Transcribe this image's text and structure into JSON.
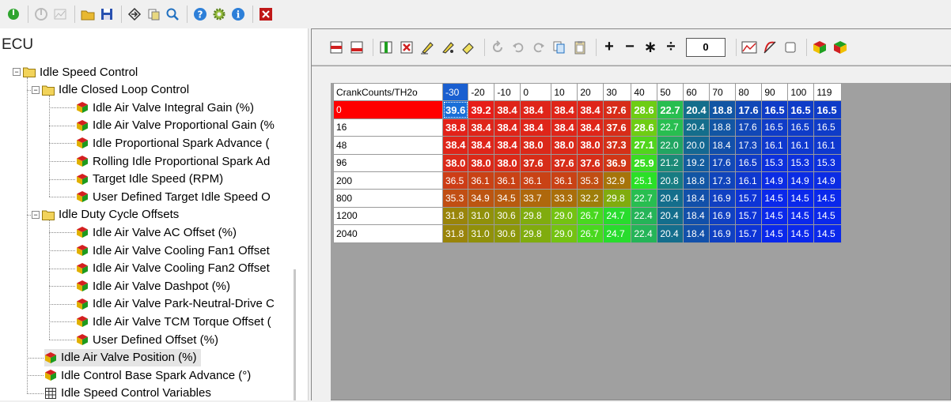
{
  "tree": {
    "title": "ECU",
    "items": [
      {
        "label": "Idle Speed Control",
        "icon": "folder-icon",
        "level": 0,
        "expander": "−"
      },
      {
        "label": "Idle Closed Loop Control",
        "icon": "folder-icon",
        "level": 1,
        "expander": "−"
      },
      {
        "label": "Idle Air Valve Integral Gain (%)",
        "icon": "cube-icon",
        "level": 2
      },
      {
        "label": "Idle Air Valve Proportional Gain (%",
        "icon": "cube-icon",
        "level": 2
      },
      {
        "label": "Idle Proportional Spark Advance (",
        "icon": "cube-icon",
        "level": 2
      },
      {
        "label": "Rolling Idle Proportional Spark Ad",
        "icon": "cube-icon",
        "level": 2
      },
      {
        "label": "Target Idle Speed (RPM)",
        "icon": "cube-icon",
        "level": 2
      },
      {
        "label": "User Defined Target Idle Speed O",
        "icon": "cube-icon",
        "level": 2
      },
      {
        "label": "Idle Duty Cycle Offsets",
        "icon": "folder-icon",
        "level": 1,
        "expander": "−"
      },
      {
        "label": "Idle Air Valve AC Offset (%)",
        "icon": "cube-icon",
        "level": 2
      },
      {
        "label": "Idle Air Valve Cooling Fan1 Offset",
        "icon": "cube-icon",
        "level": 2
      },
      {
        "label": "Idle Air Valve Cooling Fan2 Offset",
        "icon": "cube-icon",
        "level": 2
      },
      {
        "label": "Idle Air Valve Dashpot (%)",
        "icon": "cube-icon",
        "level": 2
      },
      {
        "label": "Idle Air Valve Park-Neutral-Drive C",
        "icon": "cube-icon",
        "level": 2
      },
      {
        "label": "Idle Air Valve TCM Torque Offset (",
        "icon": "cube-icon",
        "level": 2
      },
      {
        "label": "User Defined Offset (%)",
        "icon": "cube-icon",
        "level": 2
      },
      {
        "label": "Idle Air Valve Position (%)",
        "icon": "cube-icon",
        "level": 1,
        "selected": true
      },
      {
        "label": "Idle Control Base Spark Advance (°)",
        "icon": "cube-icon",
        "level": 1
      },
      {
        "label": "Idle Speed Control Variables",
        "icon": "grid-icon",
        "level": 1
      }
    ]
  },
  "editor": {
    "value_input": "0"
  },
  "table": {
    "axis_label": "CrankCounts/TH2o",
    "columns": [
      "-30",
      "-20",
      "-10",
      "0",
      "10",
      "20",
      "30",
      "40",
      "50",
      "60",
      "70",
      "80",
      "90",
      "100",
      "119"
    ],
    "rows": [
      {
        "label": "0",
        "values": [
          "39.6",
          "39.2",
          "38.4",
          "38.4",
          "38.4",
          "38.4",
          "37.6",
          "28.6",
          "22.7",
          "20.4",
          "18.8",
          "17.6",
          "16.5",
          "16.5",
          "16.5"
        ],
        "bold": true
      },
      {
        "label": "16",
        "values": [
          "38.8",
          "38.4",
          "38.4",
          "38.4",
          "38.4",
          "38.4",
          "37.6",
          "28.6",
          "22.7",
          "20.4",
          "18.8",
          "17.6",
          "16.5",
          "16.5",
          "16.5"
        ],
        "bold": true,
        "bold_until": 8
      },
      {
        "label": "48",
        "values": [
          "38.4",
          "38.4",
          "38.4",
          "38.0",
          "38.0",
          "38.0",
          "37.3",
          "27.1",
          "22.0",
          "20.0",
          "18.4",
          "17.3",
          "16.1",
          "16.1",
          "16.1"
        ],
        "bold": true,
        "bold_until": 8
      },
      {
        "label": "96",
        "values": [
          "38.0",
          "38.0",
          "38.0",
          "37.6",
          "37.6",
          "37.6",
          "36.9",
          "25.9",
          "21.2",
          "19.2",
          "17.6",
          "16.5",
          "15.3",
          "15.3",
          "15.3"
        ],
        "bold": true,
        "bold_until": 8
      },
      {
        "label": "200",
        "values": [
          "36.5",
          "36.1",
          "36.1",
          "36.1",
          "36.1",
          "35.3",
          "32.9",
          "25.1",
          "20.8",
          "18.8",
          "17.3",
          "16.1",
          "14.9",
          "14.9",
          "14.9"
        ],
        "bold": false
      },
      {
        "label": "800",
        "values": [
          "35.3",
          "34.9",
          "34.5",
          "33.7",
          "33.3",
          "32.2",
          "29.8",
          "22.7",
          "20.4",
          "18.4",
          "16.9",
          "15.7",
          "14.5",
          "14.5",
          "14.5"
        ],
        "bold": false
      },
      {
        "label": "1200",
        "values": [
          "31.8",
          "31.0",
          "30.6",
          "29.8",
          "29.0",
          "26.7",
          "24.7",
          "22.4",
          "20.4",
          "18.4",
          "16.9",
          "15.7",
          "14.5",
          "14.5",
          "14.5"
        ],
        "bold": false
      },
      {
        "label": "2040",
        "values": [
          "31.8",
          "31.0",
          "30.6",
          "29.8",
          "29.0",
          "26.7",
          "24.7",
          "22.4",
          "20.4",
          "18.4",
          "16.9",
          "15.7",
          "14.5",
          "14.5",
          "14.5"
        ],
        "bold": false
      }
    ],
    "selected_row": 0,
    "selected_col": 0
  },
  "colors": {
    "active_row_header": "#ff0000",
    "active_col_header": "#1a5fd0"
  }
}
